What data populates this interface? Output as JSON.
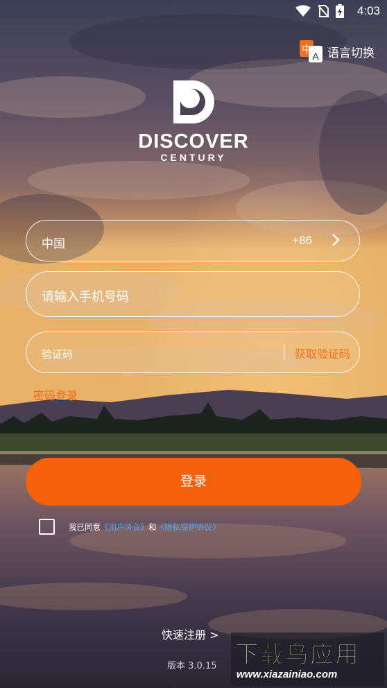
{
  "status_bar": {
    "time": "4:03"
  },
  "language_switch": {
    "label": "语言切换",
    "icon_glyph_cn": "中",
    "icon_glyph_en": "A"
  },
  "logo": {
    "title": "DISCOVER",
    "subtitle": "CENTURY"
  },
  "form": {
    "country": {
      "name": "中国",
      "code": "+86"
    },
    "phone": {
      "placeholder": "请输入手机号码"
    },
    "verify_code": {
      "placeholder": "验证码",
      "get_code_label": "获取验证码"
    }
  },
  "password_login_label": "密码登录",
  "login_button_label": "登录",
  "agreement": {
    "prefix": "我已同意",
    "user_agreement": "《用户协议》",
    "conjunction": "和",
    "privacy_policy": "《隐私保护协议》",
    "checked": false
  },
  "register_label": "快速注册  >",
  "version": "版本 3.0.15",
  "watermark": {
    "title": "下载鸟应用",
    "url": "www.xiazainiao.com"
  },
  "colors": {
    "accent": "#f5600a",
    "link": "#4da3f5"
  }
}
